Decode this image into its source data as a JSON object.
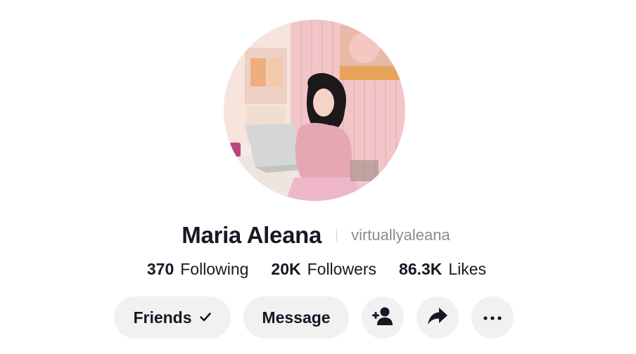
{
  "profile": {
    "display_name": "Maria Aleana",
    "username": "virtuallyaleana"
  },
  "stats": [
    {
      "value": "370",
      "label": "Following"
    },
    {
      "value": "20K",
      "label": "Followers"
    },
    {
      "value": "86.3K",
      "label": "Likes"
    }
  ],
  "actions": {
    "friends_label": "Friends",
    "message_label": "Message"
  },
  "icons": {
    "friends_check": "check-icon",
    "add_friend": "add-user-icon",
    "share": "share-arrow-icon",
    "more": "more-dots-icon"
  },
  "colors": {
    "text": "#161823",
    "muted": "#8a8b91",
    "button_bg": "#f1f1f2"
  }
}
